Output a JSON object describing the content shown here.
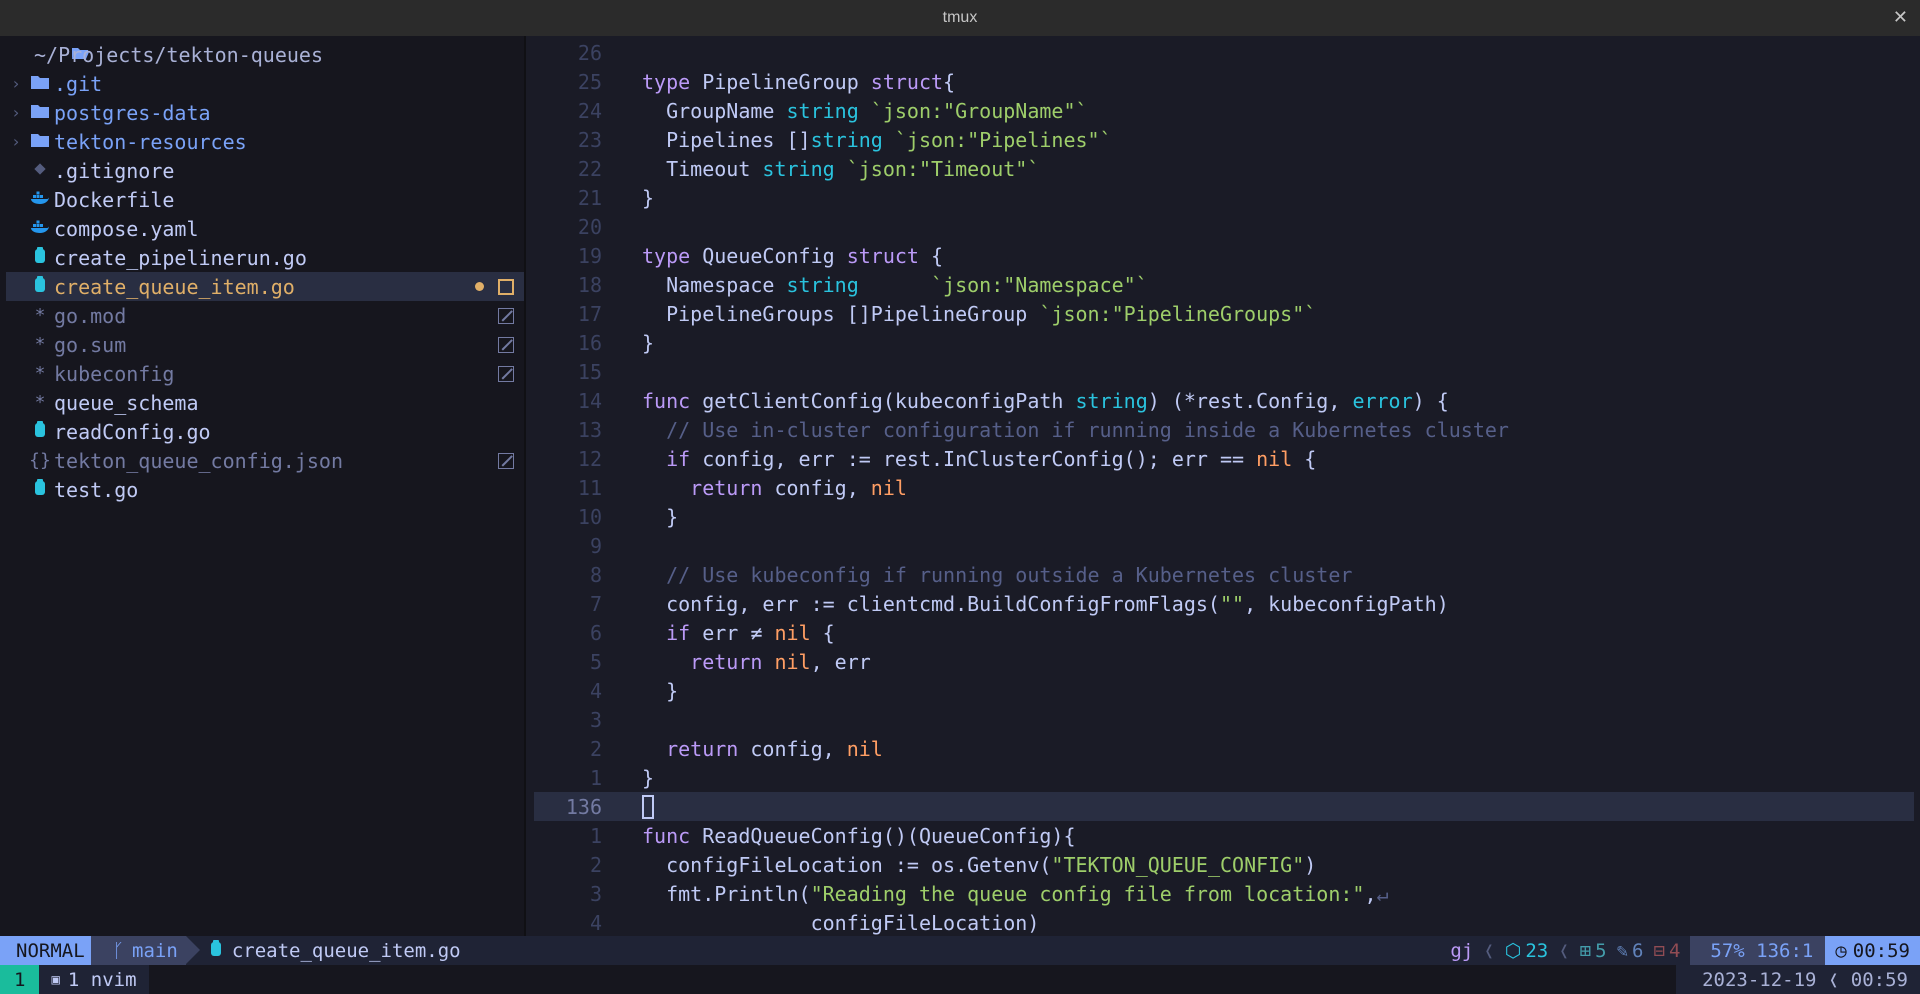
{
  "window": {
    "title": "tmux"
  },
  "tree": {
    "root": "~/Projects/tekton-queues",
    "items": [
      {
        "name": ".git",
        "kind": "folder",
        "color": "#7aa2f7"
      },
      {
        "name": "postgres-data",
        "kind": "folder",
        "color": "#7aa2f7"
      },
      {
        "name": "tekton-resources",
        "kind": "folder",
        "color": "#7aa2f7"
      },
      {
        "name": ".gitignore",
        "kind": "git",
        "color": "#c0caf5"
      },
      {
        "name": "Dockerfile",
        "kind": "docker",
        "color": "#c0caf5"
      },
      {
        "name": "compose.yaml",
        "kind": "docker",
        "color": "#c0caf5"
      },
      {
        "name": "create_pipelinerun.go",
        "kind": "go",
        "color": "#c0caf5"
      },
      {
        "name": "create_queue_item.go",
        "kind": "go",
        "color": "#e0af68",
        "selected": true,
        "modified": true
      },
      {
        "name": "go.mod",
        "kind": "asterisk",
        "color": "#737aa2",
        "ignored": true
      },
      {
        "name": "go.sum",
        "kind": "asterisk",
        "color": "#737aa2",
        "ignored": true
      },
      {
        "name": "kubeconfig",
        "kind": "asterisk",
        "color": "#737aa2",
        "ignored": true
      },
      {
        "name": "queue_schema",
        "kind": "asterisk",
        "color": "#c0caf5"
      },
      {
        "name": "readConfig.go",
        "kind": "go",
        "color": "#c0caf5"
      },
      {
        "name": "tekton_queue_config.json",
        "kind": "json",
        "color": "#737aa2",
        "ignored": true
      },
      {
        "name": "test.go",
        "kind": "go",
        "color": "#c0caf5"
      }
    ]
  },
  "editor": {
    "lines": [
      {
        "ln": "26",
        "tokens": []
      },
      {
        "ln": "25",
        "tokens": [
          [
            "k",
            "type"
          ],
          [
            "f",
            " PipelineGroup "
          ],
          [
            "k",
            "struct"
          ],
          [
            "f",
            "{"
          ]
        ]
      },
      {
        "ln": "24",
        "tokens": [
          [
            "f",
            "  GroupName "
          ],
          [
            "t",
            "string"
          ],
          [
            "f",
            " "
          ],
          [
            "s",
            "`json:\"GroupName\"`"
          ]
        ]
      },
      {
        "ln": "23",
        "tokens": [
          [
            "f",
            "  Pipelines []"
          ],
          [
            "t",
            "string"
          ],
          [
            "f",
            " "
          ],
          [
            "s",
            "`json:\"Pipelines\"`"
          ]
        ]
      },
      {
        "ln": "22",
        "tokens": [
          [
            "f",
            "  Timeout "
          ],
          [
            "t",
            "string"
          ],
          [
            "f",
            " "
          ],
          [
            "s",
            "`json:\"Timeout\"`"
          ]
        ]
      },
      {
        "ln": "21",
        "tokens": [
          [
            "f",
            "}"
          ]
        ]
      },
      {
        "ln": "20",
        "tokens": []
      },
      {
        "ln": "19",
        "tokens": [
          [
            "k",
            "type"
          ],
          [
            "f",
            " QueueConfig "
          ],
          [
            "k",
            "struct"
          ],
          [
            "f",
            " {"
          ]
        ]
      },
      {
        "ln": "18",
        "tokens": [
          [
            "f",
            "  Namespace "
          ],
          [
            "t",
            "string"
          ],
          [
            "f",
            "      "
          ],
          [
            "s",
            "`json:\"Namespace\"`"
          ]
        ]
      },
      {
        "ln": "17",
        "tokens": [
          [
            "f",
            "  PipelineGroups []PipelineGroup "
          ],
          [
            "s",
            "`json:\"PipelineGroups\"`"
          ]
        ]
      },
      {
        "ln": "16",
        "tokens": [
          [
            "f",
            "}"
          ]
        ]
      },
      {
        "ln": "15",
        "tokens": []
      },
      {
        "ln": "14",
        "tokens": [
          [
            "k",
            "func"
          ],
          [
            "f",
            " getClientConfig(kubeconfigPath "
          ],
          [
            "t",
            "string"
          ],
          [
            "f",
            ") (*rest.Config, "
          ],
          [
            "t",
            "error"
          ],
          [
            "f",
            ") {"
          ]
        ]
      },
      {
        "ln": "13",
        "tokens": [
          [
            "c",
            "  // Use in-cluster configuration if running inside a Kubernetes cluster"
          ]
        ]
      },
      {
        "ln": "12",
        "tokens": [
          [
            "f",
            "  "
          ],
          [
            "k",
            "if"
          ],
          [
            "f",
            " config, err := rest.InClusterConfig(); err == "
          ],
          [
            "n",
            "nil"
          ],
          [
            "f",
            " {"
          ]
        ]
      },
      {
        "ln": "11",
        "tokens": [
          [
            "f",
            "    "
          ],
          [
            "k",
            "return"
          ],
          [
            "f",
            " config, "
          ],
          [
            "n",
            "nil"
          ]
        ]
      },
      {
        "ln": "10",
        "tokens": [
          [
            "f",
            "  }"
          ]
        ]
      },
      {
        "ln": "9",
        "tokens": []
      },
      {
        "ln": "8",
        "tokens": [
          [
            "c",
            "  // Use kubeconfig if running outside a Kubernetes cluster"
          ]
        ]
      },
      {
        "ln": "7",
        "tokens": [
          [
            "f",
            "  config, err := clientcmd.BuildConfigFromFlags("
          ],
          [
            "s",
            "\"\""
          ],
          [
            "f",
            ", kubeconfigPath)"
          ]
        ]
      },
      {
        "ln": "6",
        "tokens": [
          [
            "f",
            "  "
          ],
          [
            "k",
            "if"
          ],
          [
            "f",
            " err ≠ "
          ],
          [
            "n",
            "nil"
          ],
          [
            "f",
            " {"
          ]
        ]
      },
      {
        "ln": "5",
        "tokens": [
          [
            "f",
            "    "
          ],
          [
            "k",
            "return"
          ],
          [
            "f",
            " "
          ],
          [
            "n",
            "nil"
          ],
          [
            "f",
            ", err"
          ]
        ]
      },
      {
        "ln": "4",
        "tokens": [
          [
            "f",
            "  }"
          ]
        ]
      },
      {
        "ln": "3",
        "tokens": []
      },
      {
        "ln": "2",
        "tokens": [
          [
            "f",
            "  "
          ],
          [
            "k",
            "return"
          ],
          [
            "f",
            " config, "
          ],
          [
            "n",
            "nil"
          ]
        ]
      },
      {
        "ln": "1",
        "tokens": [
          [
            "f",
            "}"
          ]
        ]
      },
      {
        "ln": "136",
        "tokens": [],
        "current": true
      },
      {
        "ln": "1",
        "tokens": [
          [
            "k",
            "func"
          ],
          [
            "f",
            " ReadQueueConfig()(QueueConfig){"
          ]
        ]
      },
      {
        "ln": "2",
        "tokens": [
          [
            "f",
            "  configFileLocation := os.Getenv("
          ],
          [
            "s",
            "\"TEKTON_QUEUE_CONFIG\""
          ],
          [
            "f",
            ")"
          ]
        ]
      },
      {
        "ln": "3",
        "tokens": [
          [
            "f",
            "  fmt.Println("
          ],
          [
            "s",
            "\"Reading the queue config file from location:\""
          ],
          [
            "f",
            ","
          ],
          [
            "c",
            "↵"
          ]
        ]
      },
      {
        "ln": "4",
        "tokens": [
          [
            "f",
            "              configFileLocation)"
          ]
        ]
      }
    ]
  },
  "statusline": {
    "mode": "NORMAL",
    "branch": "main",
    "file": "create_queue_item.go",
    "keys": "gj",
    "lsp_count": "23",
    "added": "5",
    "changed": "6",
    "removed": "4",
    "position": "57% 136:1",
    "time": "00:59"
  },
  "tmux": {
    "window_index": "1",
    "window_name": "1 nvim",
    "datetime": "2023-12-19 ❬ 00:59"
  }
}
